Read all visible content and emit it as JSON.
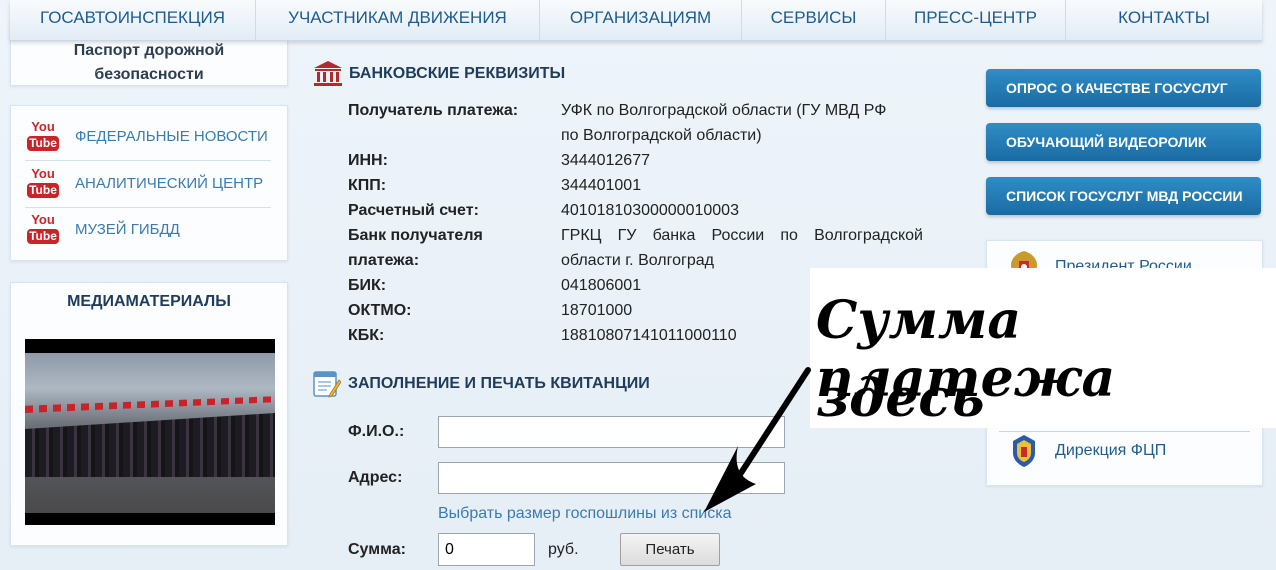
{
  "nav": {
    "items": [
      "ГОСАВТОИНСПЕКЦИЯ",
      "УЧАСТНИКАМ ДВИЖЕНИЯ",
      "ОРГАНИЗАЦИЯМ",
      "СЕРВИСЫ",
      "ПРЕСС-ЦЕНТР",
      "КОНТАКТЫ"
    ]
  },
  "left": {
    "passport_line1": "Паспорт дорожной",
    "passport_line2": "безопасности",
    "youtube_links": [
      "ФЕДЕРАЛЬНЫЕ НОВОСТИ",
      "АНАЛИТИЧЕСКИЙ ЦЕНТР",
      "МУЗЕЙ ГИБДД"
    ],
    "youtube_icon_top": "You",
    "youtube_icon_bottom": "Tube",
    "media_title": "МЕДИАМАТЕРИАЛЫ"
  },
  "bank": {
    "title": "БАНКОВСКИЕ РЕКВИЗИТЫ",
    "rows": [
      {
        "label": "Получатель платежа:",
        "value_line1": "УФК по Волгоградской области (ГУ МВД РФ",
        "value_line2": "по Волгоградской области)"
      },
      {
        "label": "ИНН:",
        "value": "3444012677"
      },
      {
        "label": "КПП:",
        "value": "344401001"
      },
      {
        "label": "Расчетный счет:",
        "value": "40101810300000010003"
      },
      {
        "label_line1": "Банк получателя",
        "label_line2": "платежа:",
        "value_line1": "ГРКЦ ГУ банка России по Волгоградской",
        "value_line2": "области г. Волгоград"
      },
      {
        "label": "БИК:",
        "value": "041806001"
      },
      {
        "label": "ОКТМО:",
        "value": "18701000"
      },
      {
        "label": "КБК:",
        "value": "18810807141011000110"
      }
    ]
  },
  "form": {
    "title": "ЗАПОЛНЕНИЕ И ПЕЧАТЬ КВИТАНЦИИ",
    "fio_label": "Ф.И.О.:",
    "fio_value": "",
    "address_label": "Адрес:",
    "address_value": "",
    "fee_link": "Выбрать размер госпошлины из списка",
    "sum_label": "Сумма:",
    "sum_value": "0",
    "currency": "руб.",
    "print_button": "Печать"
  },
  "right": {
    "buttons": [
      "ОПРОС О КАЧЕСТВЕ ГОСУСЛУГ",
      "ОБУЧАЮЩИЙ ВИДЕОРОЛИК",
      "СПИСОК ГОСУСЛУГ МВД РОССИИ"
    ],
    "links": [
      "Президент России",
      "Дирекция ФЦП"
    ]
  },
  "annotation": {
    "line1": "Сумма платежа",
    "line2": "здесь"
  },
  "colors": {
    "accent_blue": "#1b6ba3",
    "link_blue": "#3a7bb0",
    "youtube_red": "#c9242a"
  }
}
